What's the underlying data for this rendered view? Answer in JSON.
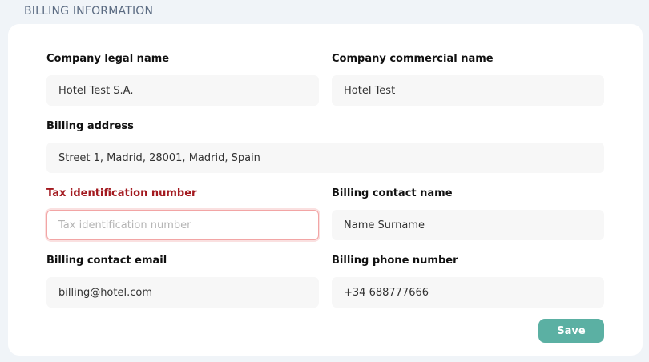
{
  "section_title": "BILLING INFORMATION",
  "fields": {
    "company_legal_name": {
      "label": "Company legal name",
      "value": "Hotel Test S.A.",
      "placeholder": ""
    },
    "company_commercial_name": {
      "label": "Company commercial name",
      "value": "Hotel Test",
      "placeholder": ""
    },
    "billing_address": {
      "label": "Billing address",
      "value": "Street 1, Madrid, 28001, Madrid, Spain",
      "placeholder": ""
    },
    "tax_id": {
      "label": "Tax identification number",
      "value": "",
      "placeholder": "Tax identification number",
      "state": "error"
    },
    "billing_contact_name": {
      "label": "Billing contact name",
      "value": "Name Surname",
      "placeholder": ""
    },
    "billing_contact_email": {
      "label": "Billing contact email",
      "value": "billing@hotel.com",
      "placeholder": ""
    },
    "billing_phone": {
      "label": "Billing phone number",
      "value": "+34 688777666",
      "placeholder": ""
    }
  },
  "save_label": "Save",
  "colors": {
    "background": "#f0f4f8",
    "card": "#ffffff",
    "error_text": "#a3191f",
    "error_border": "#f2a5a5",
    "button": "#5bb0a3"
  }
}
